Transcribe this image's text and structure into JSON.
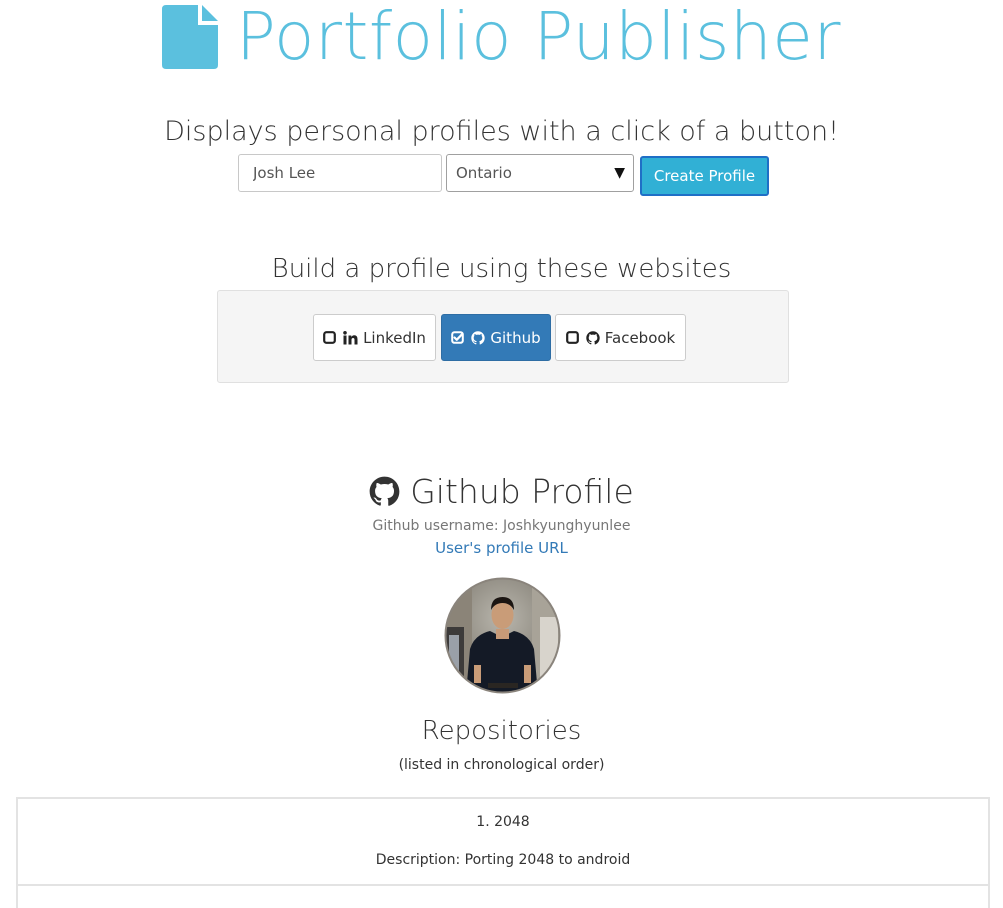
{
  "header": {
    "title": "Portfolio Publisher",
    "tagline": "Displays personal profiles with a click of a button!",
    "icon": "file-icon",
    "brand_color": "#5bc0de"
  },
  "form": {
    "name_value": "Josh Lee",
    "province_selected": "Ontario",
    "create_label": "Create Profile"
  },
  "sources": {
    "heading": "Build a profile using these websites",
    "items": [
      {
        "label": "LinkedIn",
        "checked": false,
        "icon": "linkedin-icon"
      },
      {
        "label": "Github",
        "checked": true,
        "icon": "github-icon"
      },
      {
        "label": "Facebook",
        "checked": false,
        "icon": "github-icon"
      }
    ]
  },
  "profile": {
    "heading": "Github Profile",
    "username_line": "Github username: Joshkyunghyunlee",
    "url_label": "User's profile URL"
  },
  "repositories": {
    "heading": "Repositories",
    "subheading": "(listed in chronological order)",
    "items": [
      {
        "name": "1. 2048",
        "description": "Description: Porting 2048 to android"
      }
    ]
  },
  "colors": {
    "accent": "#5bc0de",
    "primary": "#337ab7",
    "create_button": "#31b0d5"
  }
}
